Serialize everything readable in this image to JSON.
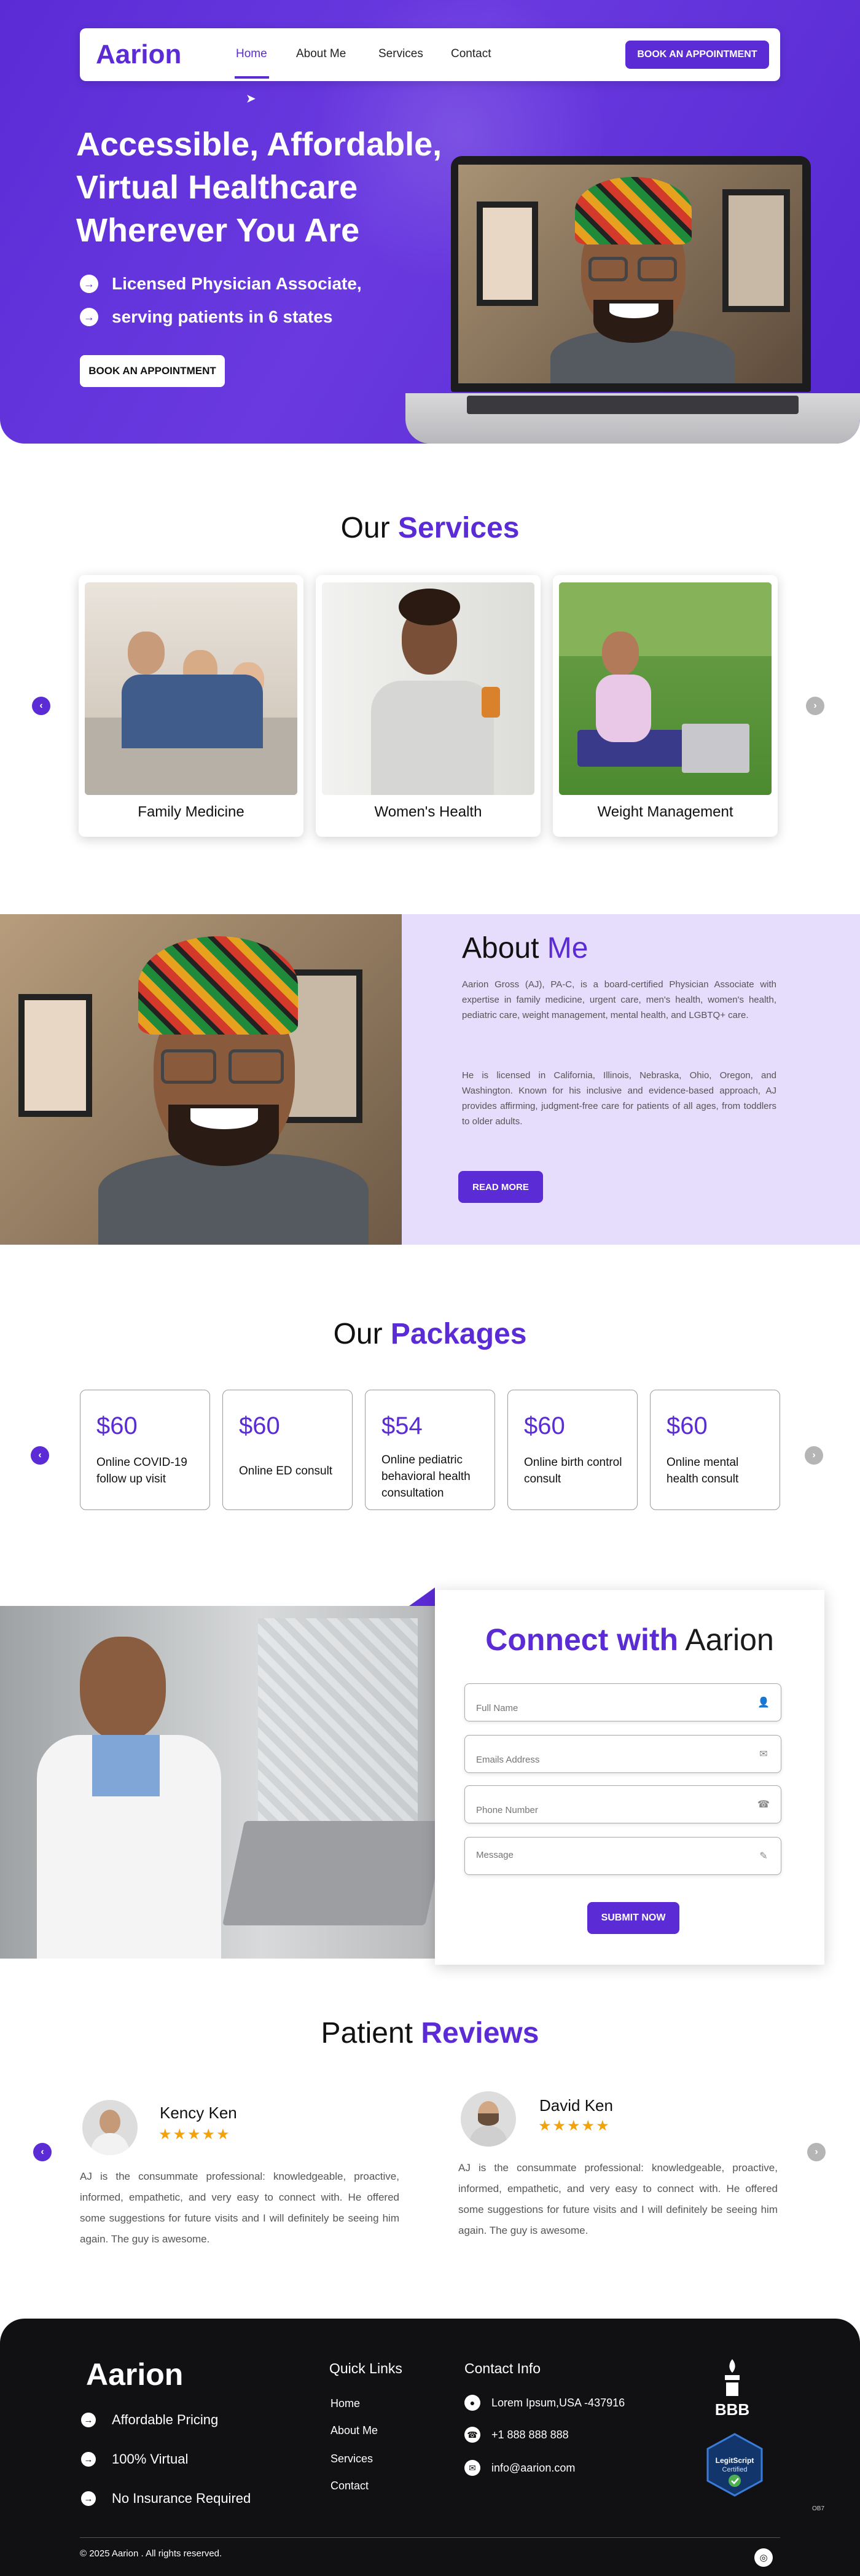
{
  "brand": {
    "name": "Aarion",
    "accent": "#5b2bd6"
  },
  "nav": {
    "items": [
      "Home",
      "About Me",
      "Services",
      "Contact"
    ],
    "active": "Home",
    "cta": "BOOK AN APPOINTMENT"
  },
  "hero": {
    "title": "Accessible, Affordable, Virtual Healthcare Wherever You Are",
    "points": [
      "Licensed Physician Associate,",
      "serving patients in 6 states"
    ],
    "cta": "BOOK AN APPOINTMENT"
  },
  "services": {
    "title_prefix": "Our ",
    "title_highlight": "Services",
    "cards": [
      "Family Medicine",
      "Women's Health",
      "Weight Management"
    ]
  },
  "about": {
    "title_prefix": "About ",
    "title_highlight": "Me",
    "paragraph1": "Aarion Gross (AJ), PA-C, is a board-certified Physician Associate with expertise in family medicine, urgent care, men's health, women's health, pediatric care, weight management, mental health, and LGBTQ+ care.",
    "paragraph2": "He is licensed in California, Illinois, Nebraska, Ohio, Oregon, and Washington. Known for his inclusive and evidence-based approach, AJ provides affirming, judgment-free care for patients of all ages, from toddlers to older adults.",
    "cta": "READ MORE"
  },
  "packages": {
    "title_prefix": "Our ",
    "title_highlight": "Packages",
    "items": [
      {
        "price": "$60",
        "desc": "Online COVID-19 follow up visit"
      },
      {
        "price": "$60",
        "desc": "Online ED consult"
      },
      {
        "price": "$54",
        "desc": "Online pediatric behavioral health consultation"
      },
      {
        "price": "$60",
        "desc": "Online birth control consult"
      },
      {
        "price": "$60",
        "desc": "Online mental health consult"
      }
    ]
  },
  "connect": {
    "title_highlight": "Connect with",
    "title_suffix": " Aarion",
    "fields": {
      "name_placeholder": "Full Name",
      "email_placeholder": "Emails Address",
      "phone_placeholder": "Phone Number",
      "message_placeholder": "Message"
    },
    "submit": "SUBMIT NOW"
  },
  "reviews": {
    "title_prefix": "Patient ",
    "title_highlight": "Reviews",
    "items": [
      {
        "name": "Kency Ken",
        "stars": "★★★★★",
        "text": "AJ is the consummate professional: knowledgeable, proactive, informed, empathetic, and very easy to connect with. He offered some suggestions for future visits and I will definitely be seeing him again. The guy is awesome."
      },
      {
        "name": "David Ken",
        "stars": "★★★★★",
        "text": "AJ is the consummate professional: knowledgeable, proactive, informed, empathetic, and very easy to connect with. He offered some suggestions for future visits and I will definitely be seeing him again. The guy is awesome."
      }
    ]
  },
  "footer": {
    "logo": "Aarion",
    "features": [
      "Affordable Pricing",
      "100% Virtual",
      "No Insurance Required"
    ],
    "quick_links_title": "Quick Links",
    "quick_links": [
      "Home",
      "About Me",
      "Services",
      "Contact"
    ],
    "contact_title": "Contact Info",
    "address": "Lorem Ipsum,USA -437916",
    "phone": "+1 888 888 888",
    "email": "info@aarion.com",
    "bbb": "BBB",
    "legit_line1": "LegitScript",
    "legit_line2": "Certified",
    "copyright": "© 2025 Aarion . All rights reserved.",
    "small_tag": "OB7"
  },
  "icons": {
    "arrow_left": "‹",
    "arrow_right": "›",
    "point": "→",
    "user": "👤",
    "mail": "✉",
    "phone": "☎",
    "edit": "✎",
    "location": "●",
    "instagram": "◎"
  }
}
